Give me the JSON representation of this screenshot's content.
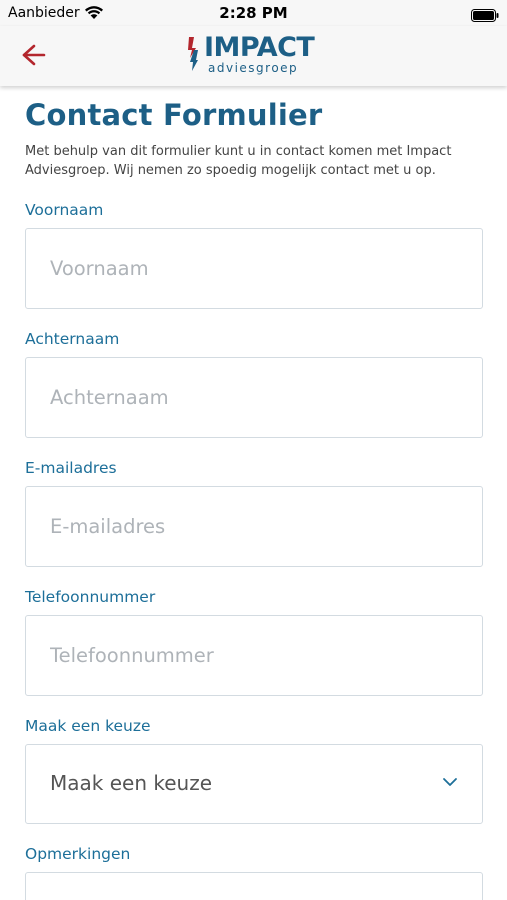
{
  "status_bar": {
    "carrier": "Aanbieder",
    "time": "2:28 PM",
    "wifi_icon": "wifi-icon",
    "battery_icon": "battery-icon"
  },
  "nav": {
    "back_icon": "arrow-left-icon",
    "logo_word": "IMPACT",
    "logo_sub": "adviesgroep"
  },
  "page": {
    "title": "Contact Formulier",
    "intro": "Met behulp van dit formulier kunt u in contact komen met Impact Adviesgroep. Wij nemen zo spoedig mogelijk contact met u op."
  },
  "form": {
    "first_name": {
      "label": "Voornaam",
      "placeholder": "Voornaam",
      "value": ""
    },
    "last_name": {
      "label": "Achternaam",
      "placeholder": "Achternaam",
      "value": ""
    },
    "email": {
      "label": "E-mailadres",
      "placeholder": "E-mailadres",
      "value": ""
    },
    "phone": {
      "label": "Telefoonnummer",
      "placeholder": "Telefoonnummer",
      "value": ""
    },
    "choice": {
      "label": "Maak een keuze",
      "selected": "Maak een keuze",
      "icon": "chevron-down-icon"
    },
    "remarks": {
      "label": "Opmerkingen"
    }
  },
  "colors": {
    "brand": "#1d5f86",
    "label": "#1d6f99",
    "back_arrow": "#b3262d",
    "border": "#d3dbe1"
  }
}
